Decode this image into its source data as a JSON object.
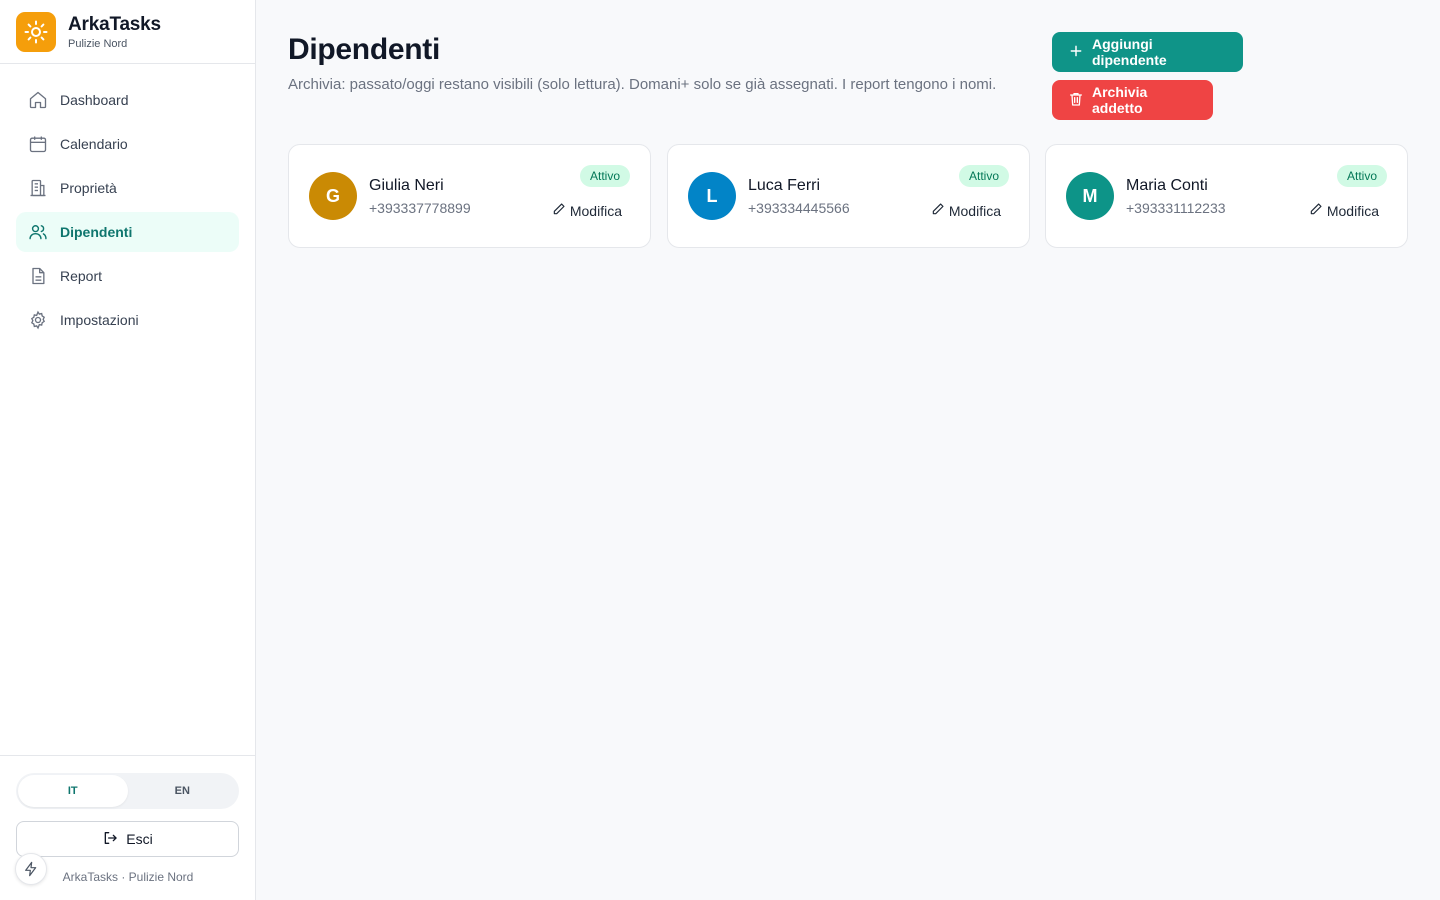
{
  "brand": {
    "name": "ArkaTasks",
    "subtitle": "Pulizie Nord",
    "logo_icon": "sun-icon",
    "logo_color": "#f59e0b"
  },
  "nav": {
    "items": [
      {
        "label": "Dashboard",
        "icon": "home-icon",
        "active": false
      },
      {
        "label": "Calendario",
        "icon": "calendar-icon",
        "active": false
      },
      {
        "label": "Proprietà",
        "icon": "building-icon",
        "active": false
      },
      {
        "label": "Dipendenti",
        "icon": "users-icon",
        "active": true
      },
      {
        "label": "Report",
        "icon": "file-text-icon",
        "active": false
      },
      {
        "label": "Impostazioni",
        "icon": "gear-icon",
        "active": false
      }
    ]
  },
  "language": {
    "options": [
      "IT",
      "EN"
    ],
    "selected": "IT"
  },
  "logout": {
    "label": "Esci"
  },
  "footer": {
    "text": "ArkaTasks · Pulizie Nord"
  },
  "page": {
    "title": "Dipendenti",
    "description": "Archivia: passato/oggi restano visibili (solo lettura). Domani+ solo se già assegnati. I report tengono i nomi."
  },
  "actions": {
    "add_label": "Aggiungi dipendente",
    "archive_label": "Archivia addetto",
    "add_color": "#0f9488",
    "archive_color": "#ef4444"
  },
  "employees": [
    {
      "initial": "G",
      "name": "Giulia Neri",
      "phone": "+393337778899",
      "status": "Attivo",
      "edit_label": "Modifica",
      "avatar_color": "#ca8a04"
    },
    {
      "initial": "L",
      "name": "Luca Ferri",
      "phone": "+393334445566",
      "status": "Attivo",
      "edit_label": "Modifica",
      "avatar_color": "#0284c7"
    },
    {
      "initial": "M",
      "name": "Maria Conti",
      "phone": "+393331112233",
      "status": "Attivo",
      "edit_label": "Modifica",
      "avatar_color": "#0d9488"
    }
  ]
}
